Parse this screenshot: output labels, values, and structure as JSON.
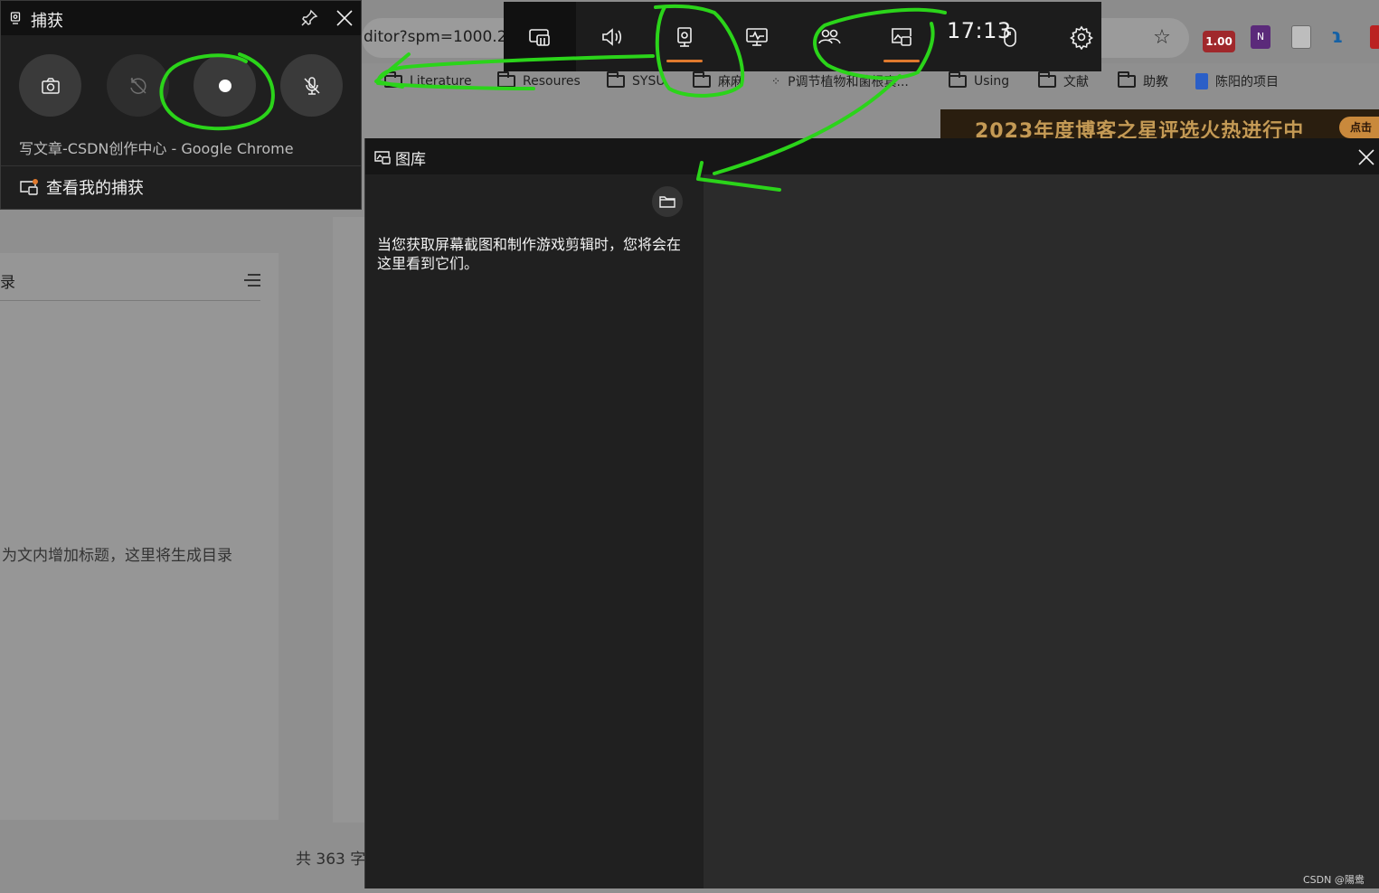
{
  "browser": {
    "address_text": "ditor?spm=1000.2",
    "extensions": {
      "counter": "1.00",
      "onenote": "N"
    },
    "bookmarks": [
      "Literature",
      "Resoures",
      "SYSU",
      "麻麻",
      "P调节植物和菌根真...",
      "Using",
      "文献",
      "助教",
      "陈阳的项目"
    ],
    "banner_text": "2023年度博客之星评选火热进行中",
    "banner_button": "点击"
  },
  "editor": {
    "toc_title": "录",
    "toc_empty": "为文内增加标题，这里将生成目录",
    "word_count": "共 363 字"
  },
  "gamebar": {
    "clock": "17:13",
    "widgets": [
      "widget-menu",
      "audio",
      "capture",
      "performance",
      "social",
      "gallery"
    ],
    "active_widgets": [
      "capture",
      "gallery"
    ]
  },
  "capture": {
    "title": "捕获",
    "app_name": "写文章-CSDN创作中心 - Google Chrome",
    "show_captures": "查看我的捕获"
  },
  "gallery": {
    "title": "图库",
    "empty_message": "当您获取屏幕截图和制作游戏剪辑时，您将会在这里看到它们。"
  },
  "watermark": "CSDN @陽鸯",
  "colors": {
    "accent": "#e07a2e",
    "annotation": "#2bd41a",
    "panel": "#1f1f1f"
  }
}
